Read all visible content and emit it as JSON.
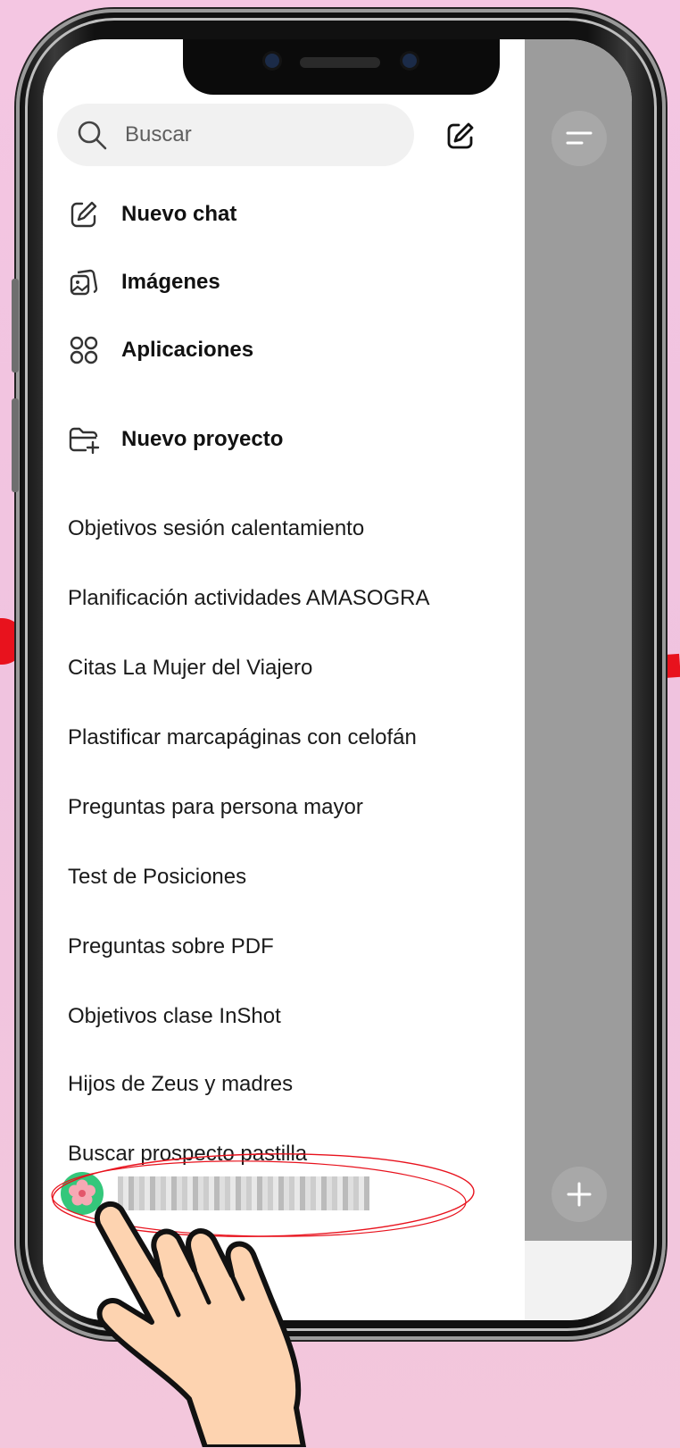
{
  "search": {
    "placeholder": "Buscar"
  },
  "menu": [
    {
      "label": "Nuevo chat",
      "icon": "compose-icon"
    },
    {
      "label": "Imágenes",
      "icon": "images-icon"
    },
    {
      "label": "Aplicaciones",
      "icon": "apps-icon"
    },
    {
      "label": "Nuevo proyecto",
      "icon": "new-folder-icon"
    }
  ],
  "chats": [
    "Objetivos sesión calentamiento",
    "Planificación actividades AMASOGRA",
    "Citas La Mujer del Viajero",
    "Plastificar marcapáginas con celofán",
    "Preguntas para persona mayor",
    "Test de Posiciones",
    "Preguntas sobre PDF",
    "Objetivos clase InShot",
    "Hijos de Zeus y madres",
    "Buscar prospecto pastilla"
  ],
  "user": {
    "avatar_icon": "flower-avatar-icon",
    "name_redacted": true
  },
  "colors": {
    "highlight": "#e8121d",
    "avatar_bg": "#34c77b",
    "overlay": "#9c9c9c"
  }
}
